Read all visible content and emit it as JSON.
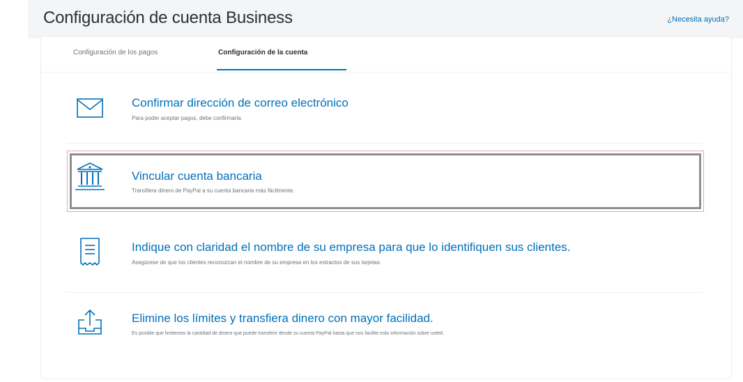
{
  "header": {
    "title": "Configuración de cuenta Business",
    "help_link": "¿Necesita ayuda?"
  },
  "tabs": [
    {
      "label": "Configuración de los pagos",
      "active": false
    },
    {
      "label": "Configuración de la cuenta",
      "active": true
    }
  ],
  "items": [
    {
      "icon": "envelope-icon",
      "title": "Confirmar dirección de correo electrónico",
      "description": "Para poder aceptar pagos, debe confirmarla."
    },
    {
      "icon": "bank-icon",
      "title": "Vincular cuenta bancaria",
      "description": "Transfiera dinero de PayPal a su cuenta bancaria más fácilmente."
    },
    {
      "icon": "receipt-icon",
      "title": "Indique con claridad el nombre de su empresa para que lo identifiquen sus clientes.",
      "description": "Asegúrese de que los clientes reconozcan el nombre de su empresa en los extractos de sus tarjetas."
    },
    {
      "icon": "upload-tray-icon",
      "title": "Elimine los límites y transfiera dinero con mayor facilidad.",
      "description": "Es posible que limitemos la cantidad de dinero que puede transferir desde su cuenta PayPal hasta que nos facilite más información sobre usted."
    }
  ],
  "colors": {
    "accent": "#0070ba",
    "highlight_outer": "#e8a8b0",
    "highlight_inner": "#8e8e8e"
  }
}
